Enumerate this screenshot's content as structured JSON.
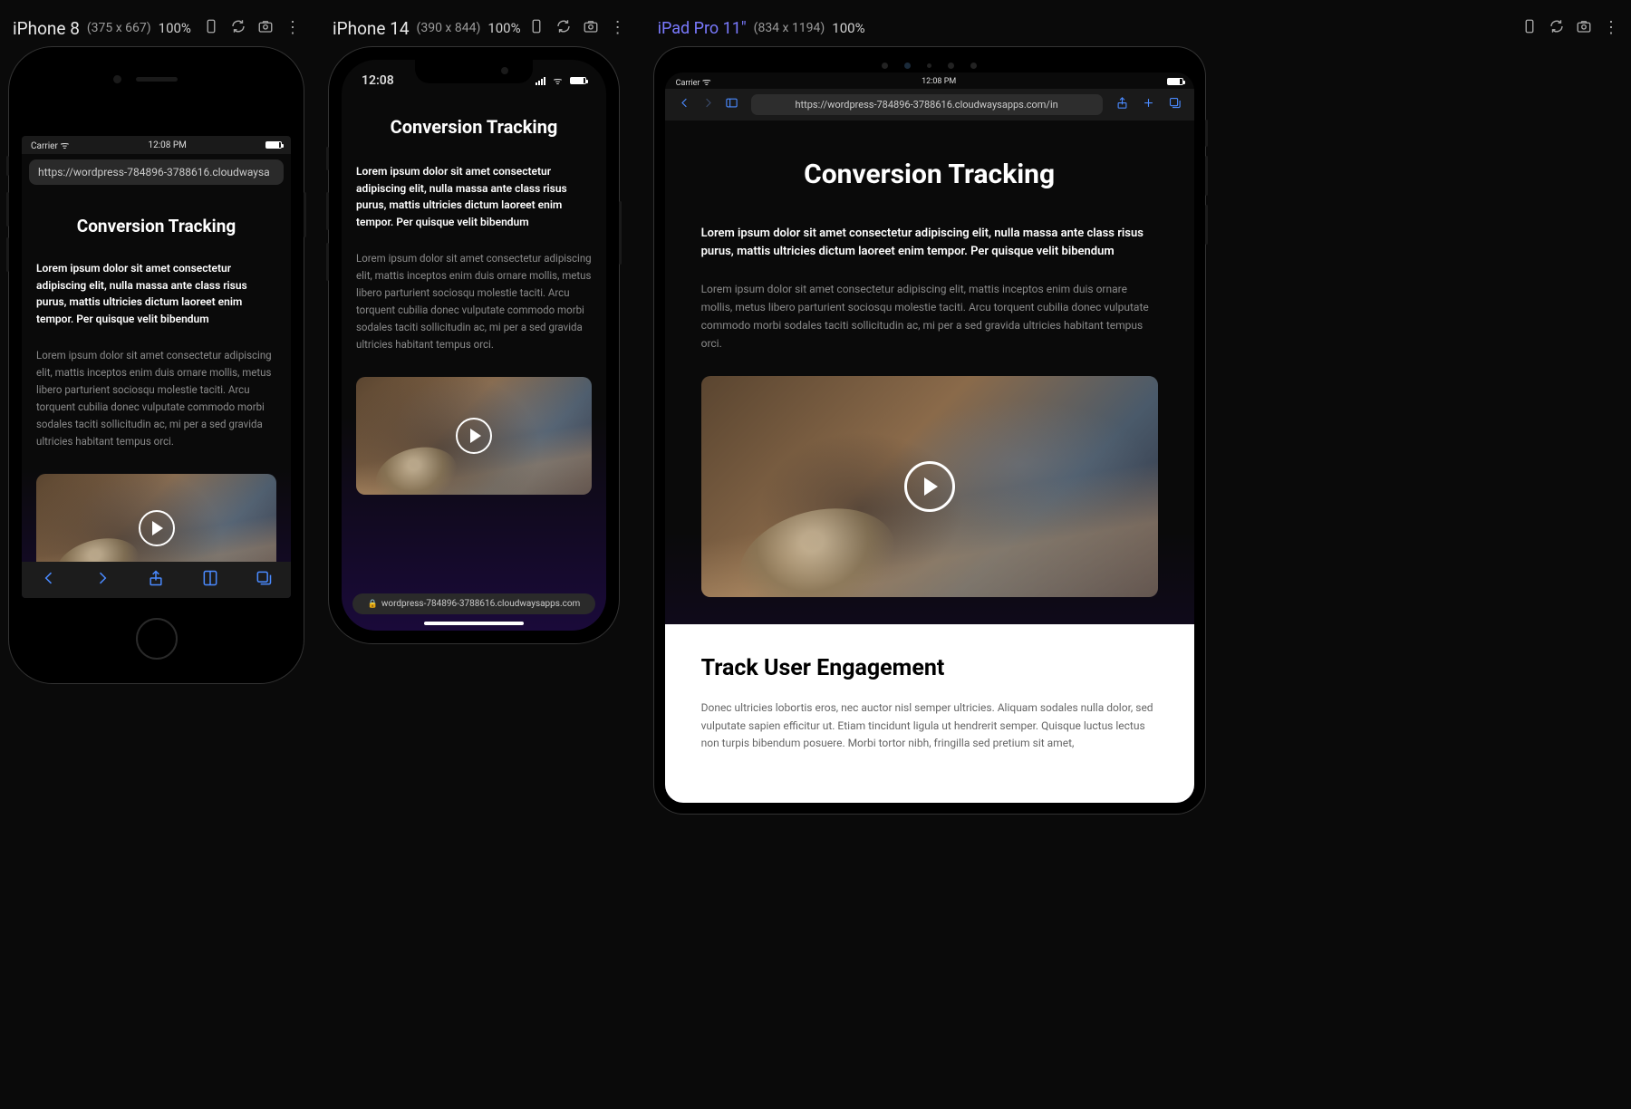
{
  "devices": {
    "iphone8": {
      "name": "iPhone 8",
      "dims": "(375 x 667)",
      "zoom": "100%",
      "status_carrier": "Carrier",
      "status_time": "12:08 PM"
    },
    "iphone14": {
      "name": "iPhone 14",
      "dims": "(390 x 844)",
      "zoom": "100%",
      "status_time": "12:08"
    },
    "ipad": {
      "name": "iPad Pro 11\"",
      "dims": "(834 x 1194)",
      "zoom": "100%",
      "status_carrier": "Carrier",
      "status_time": "12:08 PM"
    }
  },
  "urls": {
    "iphone8": "https://wordpress-784896-3788616.cloudwaysa",
    "iphone14": "wordpress-784896-3788616.cloudwaysapps.com",
    "ipad": "https://wordpress-784896-3788616.cloudwaysapps.com/in"
  },
  "page": {
    "title": "Conversion Tracking",
    "lead_full": "Lorem ipsum dolor sit amet consectetur adipiscing elit, nulla massa ante class risus purus, mattis ultricies dictum laoreet enim tempor. Per quisque velit bibendum",
    "body_full": "Lorem ipsum dolor sit amet consectetur adipiscing elit, mattis inceptos enim duis ornare mollis, metus libero parturient sociosqu molestie taciti. Arcu torquent cubilia donec vulputate commodo morbi sodales taciti sollicitudin ac, mi per a sed gravida ultricies habitant tempus orci.",
    "section2_title": "Track User Engagement",
    "section2_body": "Donec ultricies lobortis eros, nec auctor nisl semper ultricies. Aliquam sodales nulla dolor, sed vulputate sapien efficitur ut. Etiam tincidunt ligula ut hendrerit semper. Quisque luctus lectus non turpis bibendum posuere. Morbi tortor nibh, fringilla sed pretium sit amet,"
  }
}
